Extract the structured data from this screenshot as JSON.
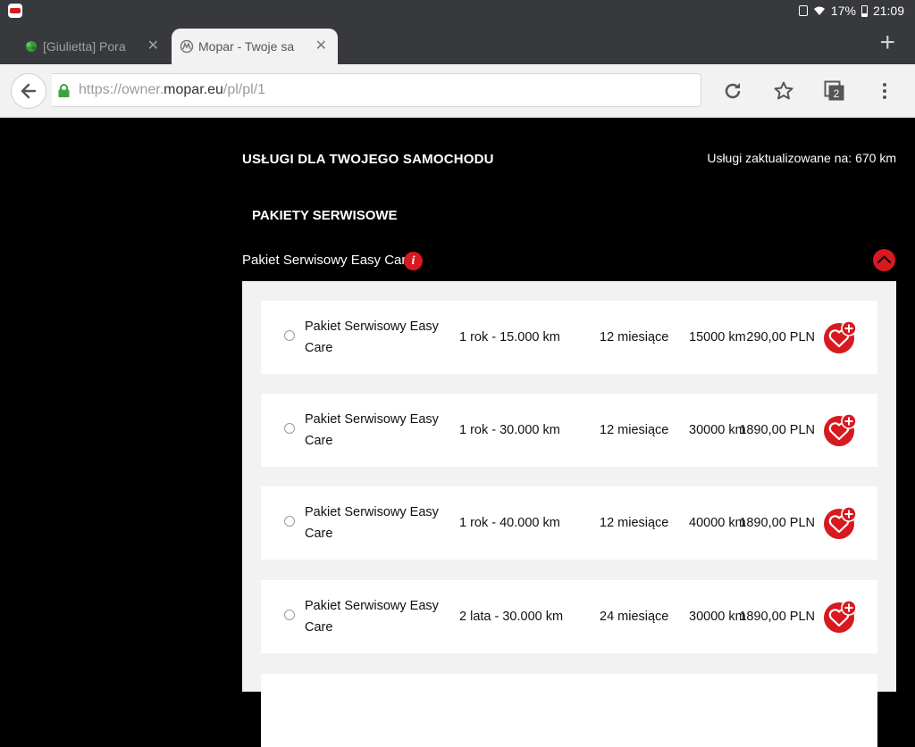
{
  "status_bar": {
    "battery": "17%",
    "time": "21:09",
    "icons": [
      "notification-icon",
      "wifi-icon",
      "battery-icon"
    ]
  },
  "tabs": [
    {
      "title": "[Giulietta] Pora",
      "active": false,
      "favicon": "leaf-favicon"
    },
    {
      "title": "Mopar - Twoje sa",
      "active": true,
      "favicon": "mopar-favicon"
    }
  ],
  "url_bar": {
    "prefix": "https://owner.",
    "host": "mopar.eu",
    "path": "/pl/pl/1",
    "secure": true
  },
  "colors": {
    "accent": "#d71920",
    "page_bg": "#000000",
    "panel_bg": "#f2f2f2",
    "chrome_dark": "#37393d"
  },
  "page": {
    "header": "USŁUGI DLA TWOJEGO SAMOCHODU",
    "update_info": "Usługi zaktualizowane na: 670 km",
    "section_title": "PAKIETY SERWISOWE",
    "package_label": "Pakiet Serwisowy Easy Care",
    "info_icon_text": "i"
  },
  "packages": [
    {
      "name": "Pakiet Serwisowy Easy Care",
      "term": "1 rok - 15.000 km",
      "months": "12 miesiące",
      "km": "15000 km",
      "price": "290,00 PLN"
    },
    {
      "name": "Pakiet Serwisowy Easy Care",
      "term": "1 rok - 30.000 km",
      "months": "12 miesiące",
      "km": "30000 km",
      "price": "1890,00 PLN"
    },
    {
      "name": "Pakiet Serwisowy Easy Care",
      "term": "1 rok - 40.000 km",
      "months": "12 miesiące",
      "km": "40000 km",
      "price": "1890,00 PLN"
    },
    {
      "name": "Pakiet Serwisowy Easy Care",
      "term": "2 lata - 30.000 km",
      "months": "24 miesiące",
      "km": "30000 km",
      "price": "1890,00 PLN"
    }
  ]
}
